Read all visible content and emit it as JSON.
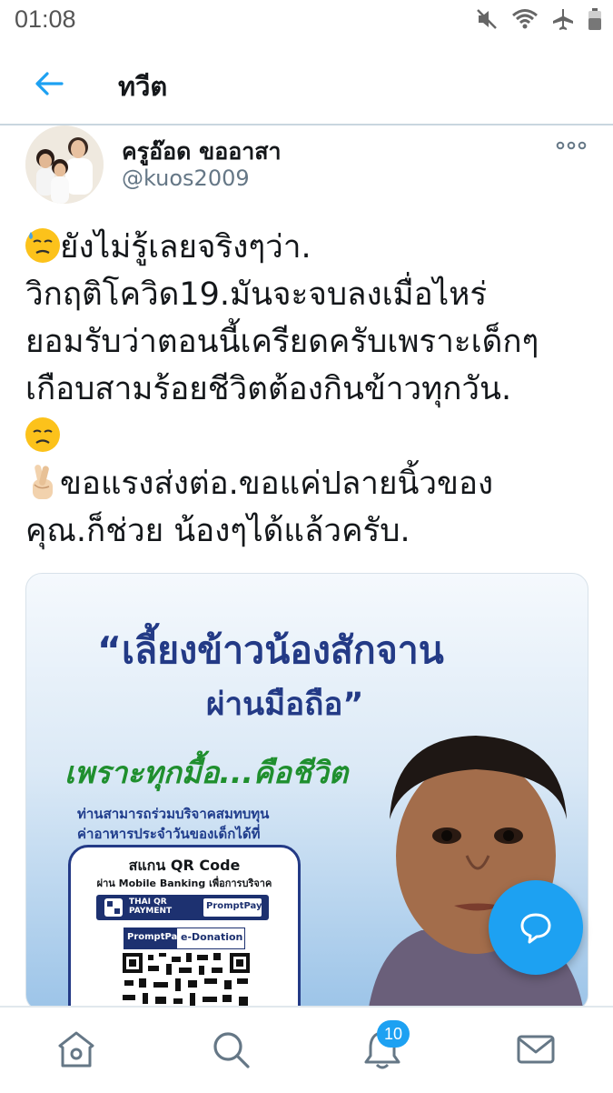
{
  "status_bar": {
    "time": "01:08"
  },
  "header": {
    "title": "ทวีต"
  },
  "tweet": {
    "author_name": "ครูอ๊อด ขออาสา",
    "author_handle": "@kuos2009",
    "lines": [
      "ยังไม่รู้เลยจริงๆว่า.",
      "วิกฤติโควิด19.มันจะจบลงเมื่อไหร่",
      "ยอมรับว่าตอนนี้เครียดครับเพราะเด็กๆ",
      "เกือบสามร้อยชีวิตต้องกินข้าวทุกวัน.",
      "ขอแรงส่งต่อ.ขอแค่ปลายนิ้วของ",
      "คุณ.ก็ช่วย น้องๆได้แล้วครับ."
    ],
    "emojis": [
      "downcast-sweat-face",
      "disappointed-face",
      "crossed-fingers"
    ]
  },
  "media": {
    "title_line1": "“เลี้ยงข้าวน้องสักจาน",
    "title_line2": "ผ่านมือถือ”",
    "subtitle": "เพราะทุกมื้อ...คือชีวิต",
    "desc_line1": "ท่านสามารถร่วมบริจาคสมทบทุน",
    "desc_line2": "ค่าอาหารประจำวันของเด็กได้ที่",
    "qr_title": "สแกน QR Code",
    "qr_subtitle": "ผ่าน Mobile Banking เพื่อการบริจาค",
    "thai_qr_label_1": "THAI QR",
    "thai_qr_label_2": "PAYMENT",
    "promptpay_label": "PromptPay",
    "edonation_label": "e-Donation"
  },
  "bottom_nav": {
    "items": [
      "home-icon",
      "search-icon",
      "notifications-icon",
      "messages-icon"
    ],
    "notification_count": "10"
  },
  "colors": {
    "accent": "#1da1f2",
    "poster_title": "#233a86",
    "poster_subtitle": "#1f8f2e"
  }
}
